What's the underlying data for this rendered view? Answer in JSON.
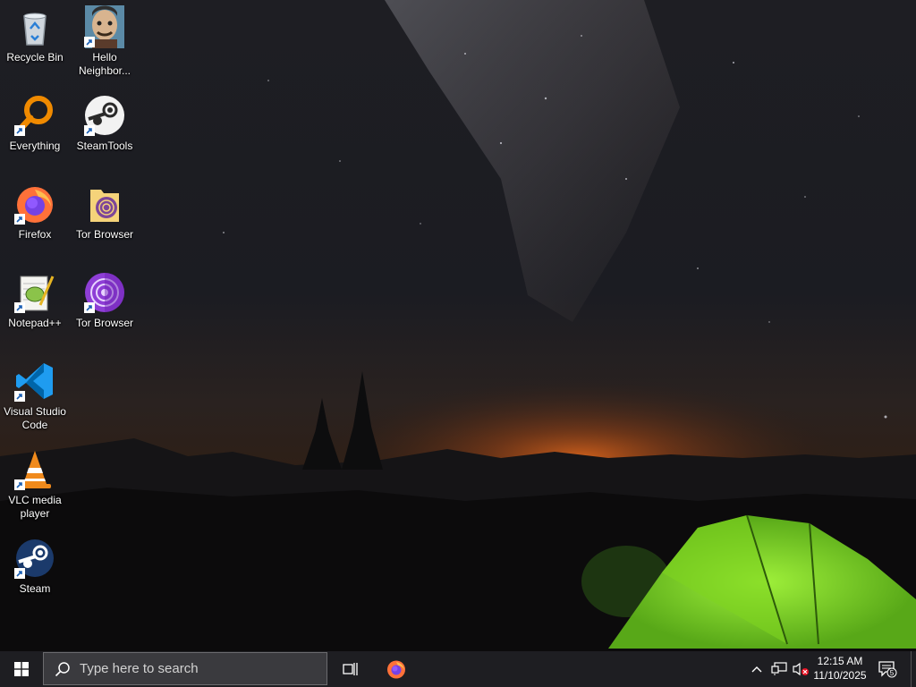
{
  "desktop": {
    "icons": [
      {
        "label": "Recycle Bin",
        "icon": "recycle-bin-icon",
        "shortcut": false
      },
      {
        "label": "Hello Neighbor...",
        "icon": "hello-neighbor-icon",
        "shortcut": true
      },
      {
        "label": "Everything",
        "icon": "everything-search-icon",
        "shortcut": true
      },
      {
        "label": "SteamTools",
        "icon": "steamtools-icon",
        "shortcut": true
      },
      {
        "label": "Firefox",
        "icon": "firefox-icon",
        "shortcut": true
      },
      {
        "label": "Tor Browser",
        "icon": "tor-browser-folder-icon",
        "shortcut": false
      },
      {
        "label": "Notepad++",
        "icon": "notepad-plus-plus-icon",
        "shortcut": true
      },
      {
        "label": "Tor Browser",
        "icon": "tor-browser-icon",
        "shortcut": true
      },
      {
        "label": "Visual Studio Code",
        "icon": "vscode-icon",
        "shortcut": true
      },
      {
        "label": "VLC media player",
        "icon": "vlc-icon",
        "shortcut": true
      },
      {
        "label": "Steam",
        "icon": "steam-icon",
        "shortcut": true
      }
    ]
  },
  "taskbar": {
    "search_placeholder": "Type here to search",
    "pinned": [
      "start-windows-icon",
      "search-icon",
      "task-view-icon",
      "firefox-icon"
    ],
    "tray": {
      "icons": [
        "chevron-up-icon",
        "network-icon",
        "volume-muted-icon"
      ],
      "time": "12:15 AM",
      "date": "11/10/2025",
      "notification_count": "5"
    }
  },
  "colors": {
    "taskbar_bg": "#1e1e22",
    "search_bg": "#3a3a3e",
    "tent_green": "#7ed320",
    "horizon_orange": "#d4621c"
  }
}
